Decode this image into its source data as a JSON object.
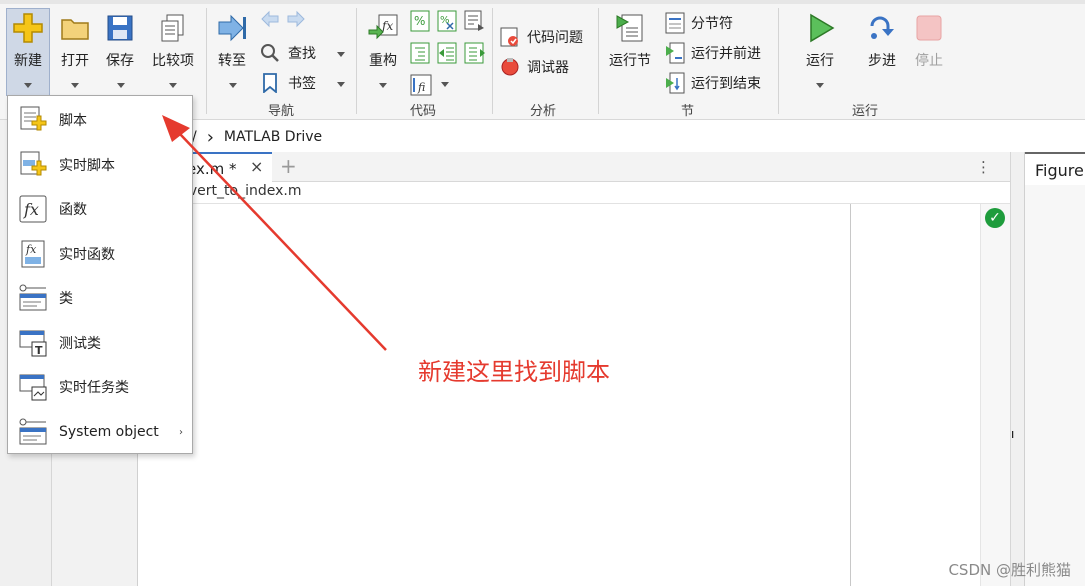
{
  "ribbon": {
    "file_buttons": [
      "新建",
      "打开",
      "保存",
      "比较项"
    ],
    "navigate": {
      "goto_label": "转至",
      "find_label": "查找",
      "bookmark_label": "书签",
      "group_label": "导航"
    },
    "code": {
      "refactor_label": "重构",
      "group_label": "代码"
    },
    "analyze": {
      "issues_label": "代码问题",
      "debugger_label": "调试器",
      "group_label": "分析"
    },
    "section": {
      "run_section_label": "运行节",
      "section_break_label": "分节符",
      "run_advance_label": "运行并前进",
      "run_to_end_label": "运行到结束",
      "group_label": "节"
    },
    "run": {
      "run_label": "运行",
      "step_label": "步进",
      "stop_label": "停止",
      "group_label": "运行"
    }
  },
  "address": {
    "separator": "/",
    "chevron": "›",
    "location": "MATLAB Drive"
  },
  "editor": {
    "tab_label": "ex.m *",
    "tab_close": "×",
    "tab_add": "+",
    "tab_more": "⋮",
    "file_path": "nvert_to_index.m"
  },
  "figure_panel": {
    "title": "Figure"
  },
  "new_menu": {
    "items": [
      {
        "label": "脚本",
        "icon": "script-icon"
      },
      {
        "label": "实时脚本",
        "icon": "live-script-icon"
      },
      {
        "label": "函数",
        "icon": "function-icon"
      },
      {
        "label": "实时函数",
        "icon": "live-function-icon"
      },
      {
        "label": "类",
        "icon": "class-icon"
      },
      {
        "label": "测试类",
        "icon": "test-class-icon"
      },
      {
        "label": "实时任务类",
        "icon": "live-task-class-icon"
      },
      {
        "label": "System object",
        "icon": "system-object-icon"
      }
    ],
    "submenu_arrow": "›"
  },
  "annotation": {
    "text": "新建这里找到脚本",
    "color": "#e53a2e"
  },
  "watermark": "CSDN @胜利熊猫",
  "colors": {
    "accent": "#3a73c4",
    "arrow": "#e53a2e",
    "ok": "#1e9c3c"
  }
}
